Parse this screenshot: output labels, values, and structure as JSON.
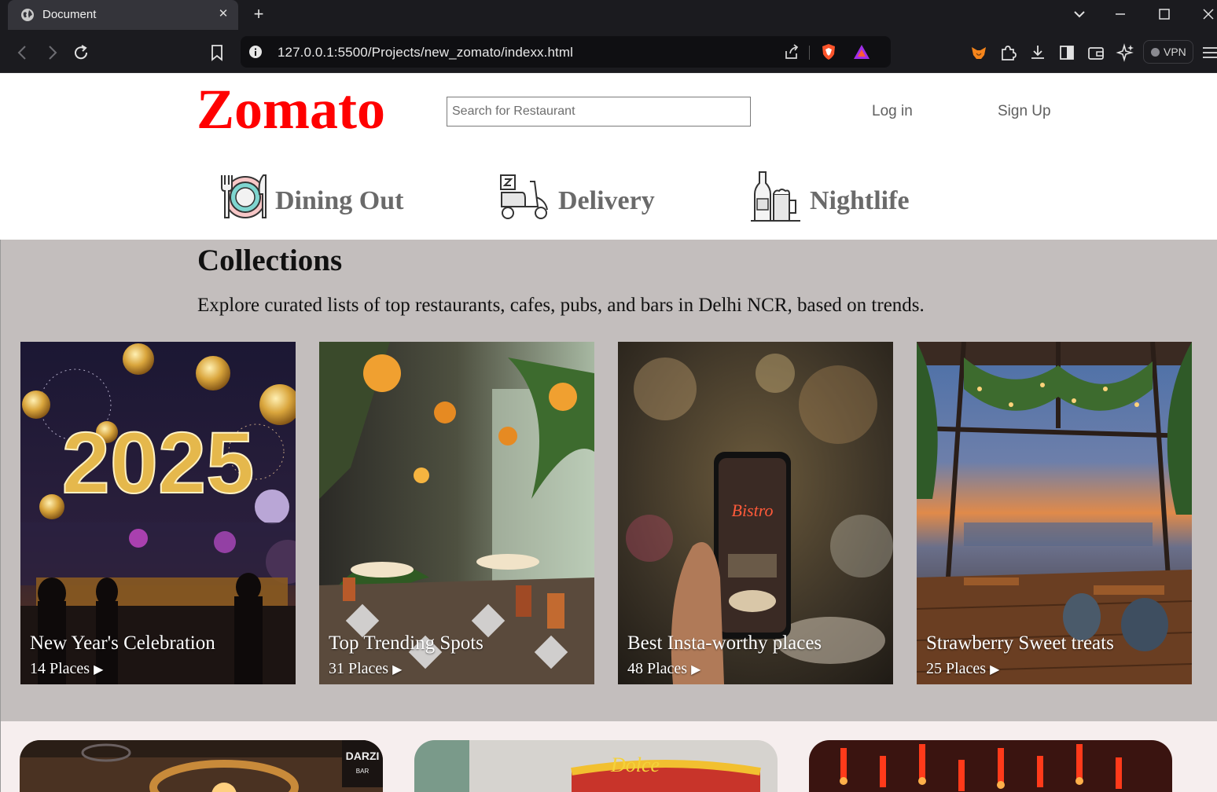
{
  "browser": {
    "tab_title": "Document",
    "tab_close": "✕",
    "new_tab": "+",
    "url": "127.0.0.1:5500/Projects/new_zomato/indexx.html",
    "vpn_label": "VPN"
  },
  "header": {
    "logo": "Zomato",
    "search_placeholder": "Search for Restaurant",
    "login": "Log in",
    "signup": "Sign Up"
  },
  "categories": [
    {
      "label": "Dining Out",
      "icon": "dining-icon"
    },
    {
      "label": "Delivery",
      "icon": "scooter-icon"
    },
    {
      "label": "Nightlife",
      "icon": "drinks-icon"
    }
  ],
  "collections": {
    "title": "Collections",
    "description": "Explore curated lists of top restaurants, cafes, pubs, and bars in Delhi NCR, based on trends.",
    "cards": [
      {
        "name": "New Year's Celebration",
        "places": "14 Places",
        "arrow": "▶"
      },
      {
        "name": "Top Trending Spots",
        "places": "31 Places",
        "arrow": "▶"
      },
      {
        "name": "Best Insta-worthy places",
        "places": "48 Places",
        "arrow": "▶"
      },
      {
        "name": "Strawberry Sweet treats",
        "places": "25 Places",
        "arrow": "▶"
      }
    ]
  },
  "colors": {
    "brand": "#ff0000",
    "collections_bg": "#c3bebd",
    "lower_bg": "#f6eeee",
    "chrome_bg": "#1b1b1f"
  }
}
